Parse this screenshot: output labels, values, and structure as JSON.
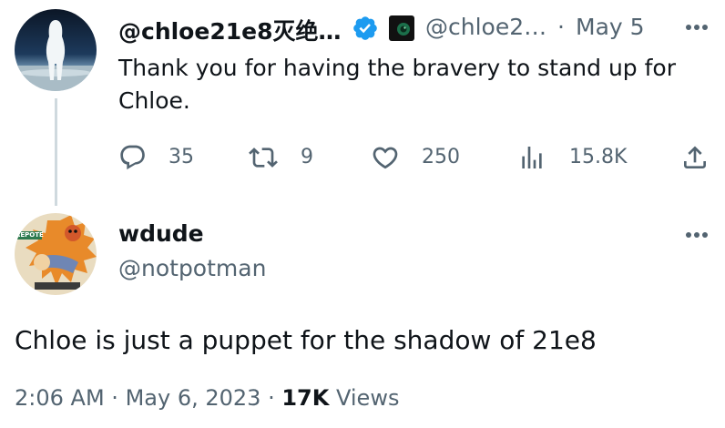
{
  "first_tweet": {
    "display_name": "@chloe21e8灭绝…",
    "handle": "@chloe2…",
    "separator": "·",
    "date": "May 5",
    "text": "Thank you for having the bravery to stand up for Chloe.",
    "verified": true,
    "actions": {
      "replies": "35",
      "retweets": "9",
      "likes": "250",
      "views": "15.8K"
    }
  },
  "second_tweet": {
    "display_name": "wdude",
    "handle": "@notpotman",
    "text": "Chloe is just a puppet for the shadow of 21e8",
    "avatar_sign": "REPOTE",
    "meta": {
      "time": "2:06 AM",
      "sep1": "·",
      "date": "May 6, 2023",
      "sep2": "·",
      "views_count": "17K",
      "views_label": "Views"
    }
  },
  "colors": {
    "verified": "#1d9bf0",
    "secondary_text": "#536471",
    "primary_text": "#0f1419",
    "thread_line": "#cfd9de"
  },
  "icons": [
    "verified-badge-icon",
    "affiliate-badge-icon",
    "more-icon",
    "reply-icon",
    "retweet-icon",
    "like-icon",
    "views-icon",
    "share-icon"
  ]
}
